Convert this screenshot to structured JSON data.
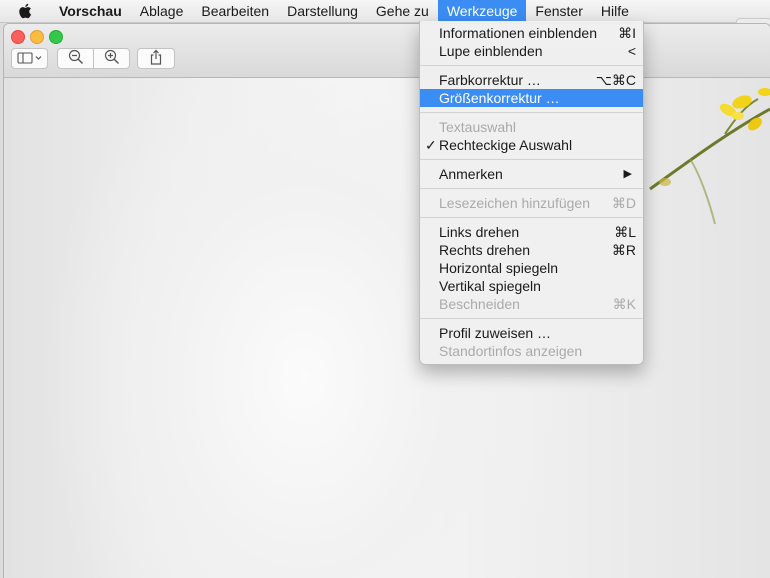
{
  "menubar": {
    "app_name": "Vorschau",
    "items": [
      "Ablage",
      "Bearbeiten",
      "Darstellung",
      "Gehe zu",
      "Werkzeuge",
      "Fenster",
      "Hilfe"
    ],
    "active_menu": "Werkzeuge"
  },
  "toolbar": {
    "icons": [
      "sidebar-toggle-icon",
      "zoom-out-icon",
      "zoom-in-icon",
      "share-icon"
    ]
  },
  "menu": {
    "items": [
      {
        "label": "Informationen einblenden",
        "shortcut": "⌘I"
      },
      {
        "label": "Lupe einblenden",
        "shortcut": "<"
      },
      {
        "label": "Farbkorrektur …",
        "shortcut": "⌥⌘C"
      },
      {
        "label": "Größenkorrektur …",
        "shortcut": ""
      },
      {
        "label": "Textauswahl",
        "shortcut": ""
      },
      {
        "label": "Rechteckige Auswahl",
        "shortcut": "",
        "check": "✓"
      },
      {
        "label": "Anmerken",
        "shortcut": "▶"
      },
      {
        "label": "Lesezeichen hinzufügen",
        "shortcut": "⌘D"
      },
      {
        "label": "Links drehen",
        "shortcut": "⌘L"
      },
      {
        "label": "Rechts drehen",
        "shortcut": "⌘R"
      },
      {
        "label": "Horizontal spiegeln",
        "shortcut": ""
      },
      {
        "label": "Vertikal spiegeln",
        "shortcut": ""
      },
      {
        "label": "Beschneiden",
        "shortcut": "⌘K"
      },
      {
        "label": "Profil zuweisen …",
        "shortcut": ""
      },
      {
        "label": "Standortinfos anzeigen",
        "shortcut": ""
      }
    ],
    "highlighted": "Größenkorrektur …",
    "disabled": [
      "Textauswahl",
      "Lesezeichen hinzufügen",
      "Beschneiden",
      "Standortinfos anzeigen"
    ]
  },
  "colors": {
    "accent": "#3b8cf3",
    "close": "#fc605c",
    "minimize": "#fdbc40",
    "zoom": "#34c84a",
    "flower": "#f2d21a"
  }
}
